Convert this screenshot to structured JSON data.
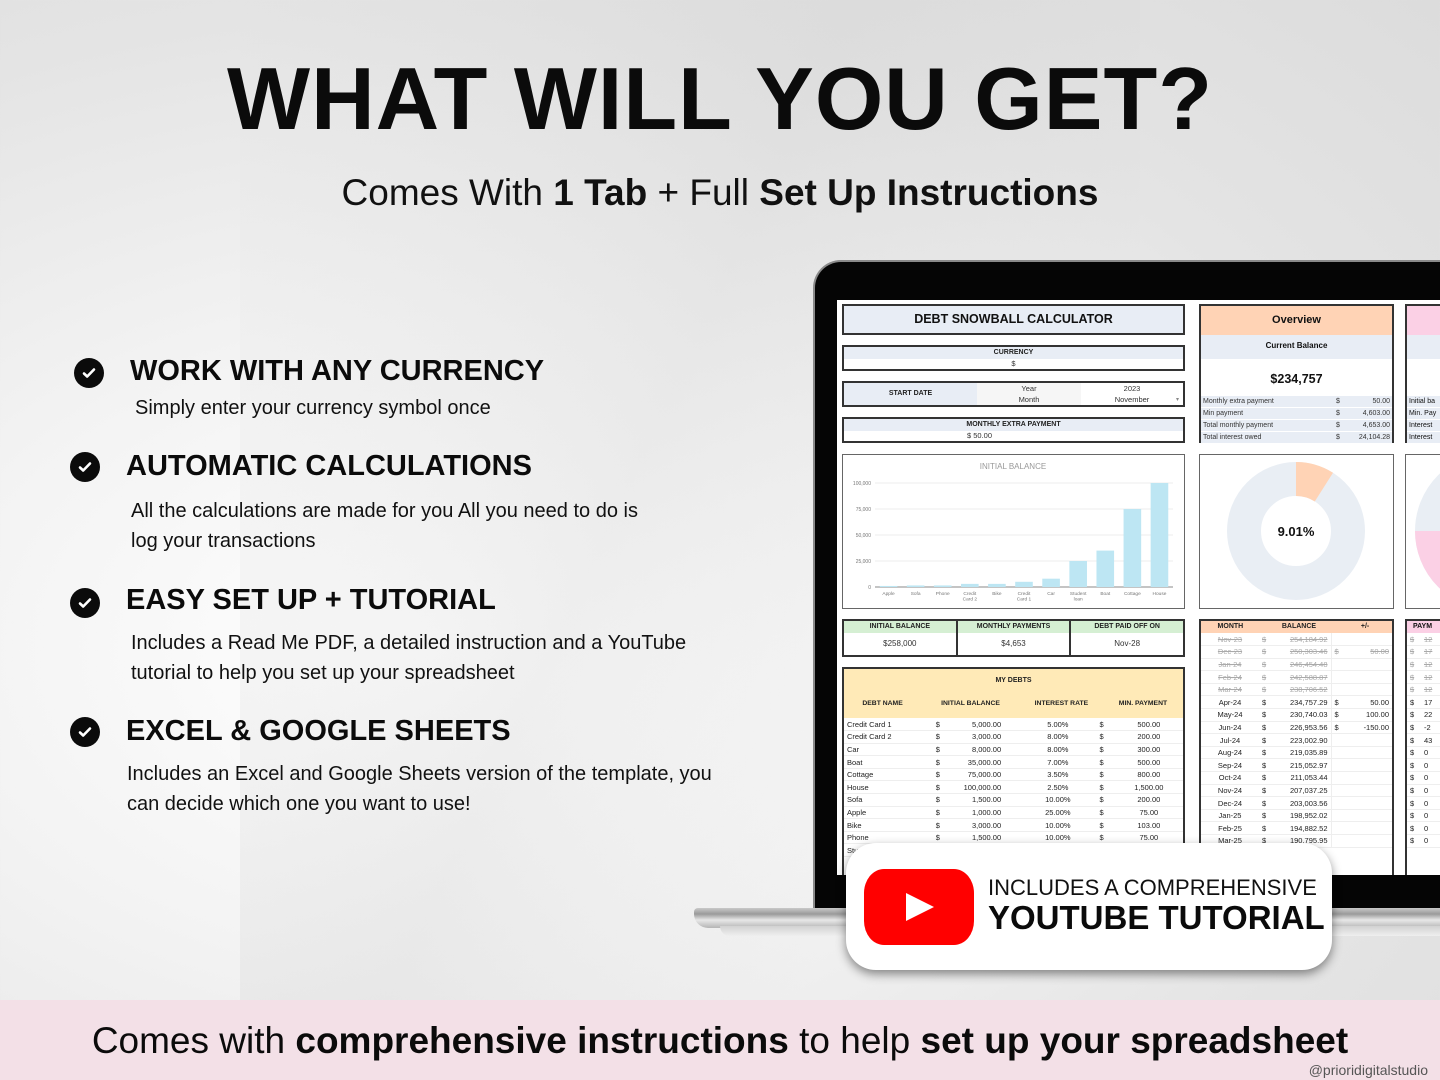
{
  "header": {
    "title": "WHAT WILL YOU GET?",
    "subtitle_parts": [
      "Comes With ",
      "1 Tab",
      " + Full ",
      "Set Up Instructions"
    ]
  },
  "features": [
    {
      "icon": "check-circle-icon",
      "title": "WORK WITH ANY CURRENCY",
      "lines": [
        "Simply enter your currency symbol once"
      ]
    },
    {
      "icon": "check-circle-icon",
      "title": "AUTOMATIC CALCULATIONS",
      "lines": [
        "All the calculations are made for you All you need to do is",
        "log your transactions"
      ]
    },
    {
      "icon": "check-circle-icon",
      "title": "EASY SET UP + TUTORIAL",
      "lines": [
        "Includes a Read Me PDF, a detailed instruction and a YouTube",
        "tutorial to help you set up your spreadsheet"
      ]
    },
    {
      "icon": "check-circle-icon",
      "title": "EXCEL & GOOGLE SHEETS",
      "lines": [
        "Includes an Excel and Google Sheets version of the template, you",
        "can decide which one you want to use!"
      ]
    }
  ],
  "sheet": {
    "title": "DEBT SNOWBALL CALCULATOR",
    "currency": {
      "label": "CURRENCY",
      "value": "$"
    },
    "start_date": {
      "label": "START DATE",
      "year_label": "Year",
      "month_label": "Month",
      "year": "2023",
      "month": "November"
    },
    "extra_payment": {
      "label": "MONTHLY EXTRA PAYMENT",
      "value": "$  50.00"
    },
    "overview": {
      "title": "Overview",
      "sub": "Current Balance",
      "balance": "$234,757",
      "rows": [
        {
          "label": "Monthly extra payment",
          "cur": "$",
          "value": "50.00"
        },
        {
          "label": "Min payment",
          "cur": "$",
          "value": "4,603.00"
        },
        {
          "label": "Total monthly payment",
          "cur": "$",
          "value": "4,653.00"
        },
        {
          "label": "Total interest owed",
          "cur": "$",
          "value": "24,104.28"
        }
      ]
    },
    "side_panel_rows": [
      "Initial ba",
      "Min. Pay",
      "Interest",
      "Interest"
    ],
    "donut": {
      "percent_label": "9.01%",
      "fraction": 0.0901,
      "accent": "#ffd3b5",
      "track": "#e9eef4"
    },
    "summary": [
      {
        "label": "INITIAL BALANCE",
        "value": "$258,000"
      },
      {
        "label": "MONTHLY PAYMENTS",
        "value": "$4,653"
      },
      {
        "label": "DEBT PAID OFF ON",
        "value": "Nov-28"
      }
    ],
    "debts": {
      "title": "MY DEBTS",
      "columns": [
        "DEBT NAME",
        "INITIAL BALANCE",
        "INTEREST RATE",
        "MIN. PAYMENT"
      ],
      "rows": [
        [
          "Credit Card 1",
          "$",
          "5,000.00",
          "5.00%",
          "$",
          "500.00"
        ],
        [
          "Credit Card 2",
          "$",
          "3,000.00",
          "8.00%",
          "$",
          "200.00"
        ],
        [
          "Car",
          "$",
          "8,000.00",
          "8.00%",
          "$",
          "300.00"
        ],
        [
          "Boat",
          "$",
          "35,000.00",
          "7.00%",
          "$",
          "500.00"
        ],
        [
          "Cottage",
          "$",
          "75,000.00",
          "3.50%",
          "$",
          "800.00"
        ],
        [
          "House",
          "$",
          "100,000.00",
          "2.50%",
          "$",
          "1,500.00"
        ],
        [
          "Sofa",
          "$",
          "1,500.00",
          "10.00%",
          "$",
          "200.00"
        ],
        [
          "Apple",
          "$",
          "1,000.00",
          "25.00%",
          "$",
          "75.00"
        ],
        [
          "Bike",
          "$",
          "3,000.00",
          "10.00%",
          "$",
          "103.00"
        ],
        [
          "Phone",
          "$",
          "1,500.00",
          "10.00%",
          "$",
          "75.00"
        ],
        [
          "Stu",
          "",
          "",
          "",
          "",
          ""
        ]
      ]
    },
    "schedule": {
      "columns": [
        "MONTH",
        "BALANCE",
        "+/-"
      ],
      "rows": [
        {
          "month": "Nov-23",
          "balance": "254,184.92",
          "delta": "",
          "paid": true
        },
        {
          "month": "Dec-23",
          "balance": "250,303.46",
          "delta": "50.00",
          "paid": true
        },
        {
          "month": "Jan-24",
          "balance": "246,454.48",
          "delta": "",
          "paid": true
        },
        {
          "month": "Feb-24",
          "balance": "242,588.87",
          "delta": "",
          "paid": true
        },
        {
          "month": "Mar-24",
          "balance": "238,706.52",
          "delta": "",
          "paid": true
        },
        {
          "month": "Apr-24",
          "balance": "234,757.29",
          "delta": "50.00",
          "paid": false
        },
        {
          "month": "May-24",
          "balance": "230,740.03",
          "delta": "100.00",
          "paid": false
        },
        {
          "month": "Jun-24",
          "balance": "226,953.56",
          "delta": "-150.00",
          "paid": false
        },
        {
          "month": "Jul-24",
          "balance": "223,002.90",
          "delta": "",
          "paid": false
        },
        {
          "month": "Aug-24",
          "balance": "219,035.89",
          "delta": "",
          "paid": false
        },
        {
          "month": "Sep-24",
          "balance": "215,052.97",
          "delta": "",
          "paid": false
        },
        {
          "month": "Oct-24",
          "balance": "211,053.44",
          "delta": "",
          "paid": false
        },
        {
          "month": "Nov-24",
          "balance": "207,037.25",
          "delta": "",
          "paid": false
        },
        {
          "month": "Dec-24",
          "balance": "203,003.56",
          "delta": "",
          "paid": false
        },
        {
          "month": "Jan-25",
          "balance": "198,952.02",
          "delta": "",
          "paid": false
        },
        {
          "month": "Feb-25",
          "balance": "194,882.52",
          "delta": "",
          "paid": false
        },
        {
          "month": "Mar-25",
          "balance": "190,795.95",
          "delta": "",
          "paid": false
        }
      ]
    },
    "payments": {
      "column": "PAYM",
      "rows": [
        "12",
        "17",
        "12",
        "12",
        "12",
        "17",
        "22",
        "-2",
        "43",
        "0",
        "0",
        "0",
        "0",
        "0",
        "0",
        "0",
        "0"
      ]
    }
  },
  "chart_data": {
    "type": "bar",
    "title": "INITIAL BALANCE",
    "categories": [
      "Apple",
      "Sofa",
      "Phone",
      "Credit Card 2",
      "Bike",
      "Credit Card 1",
      "Car",
      "Student loan",
      "Boat",
      "Cottage",
      "House"
    ],
    "values": [
      1000,
      1500,
      1500,
      3000,
      3000,
      5000,
      8000,
      25000,
      35000,
      75000,
      100000
    ],
    "ylim": [
      0,
      100000
    ],
    "yticks": [
      "0",
      "25,000",
      "50,000",
      "75,000",
      "100,000"
    ],
    "xlabel": "",
    "ylabel": "",
    "grid": true,
    "bar_color": "#bde6f3"
  },
  "youtube_badge": {
    "line1": "INCLUDES A COMPREHENSIVE",
    "line2": "YOUTUBE TUTORIAL"
  },
  "banner": {
    "parts": [
      "Comes with ",
      "comprehensive instructions",
      " to help ",
      "set up your spreadsheet"
    ],
    "handle": "@prioridigitalstudio"
  }
}
